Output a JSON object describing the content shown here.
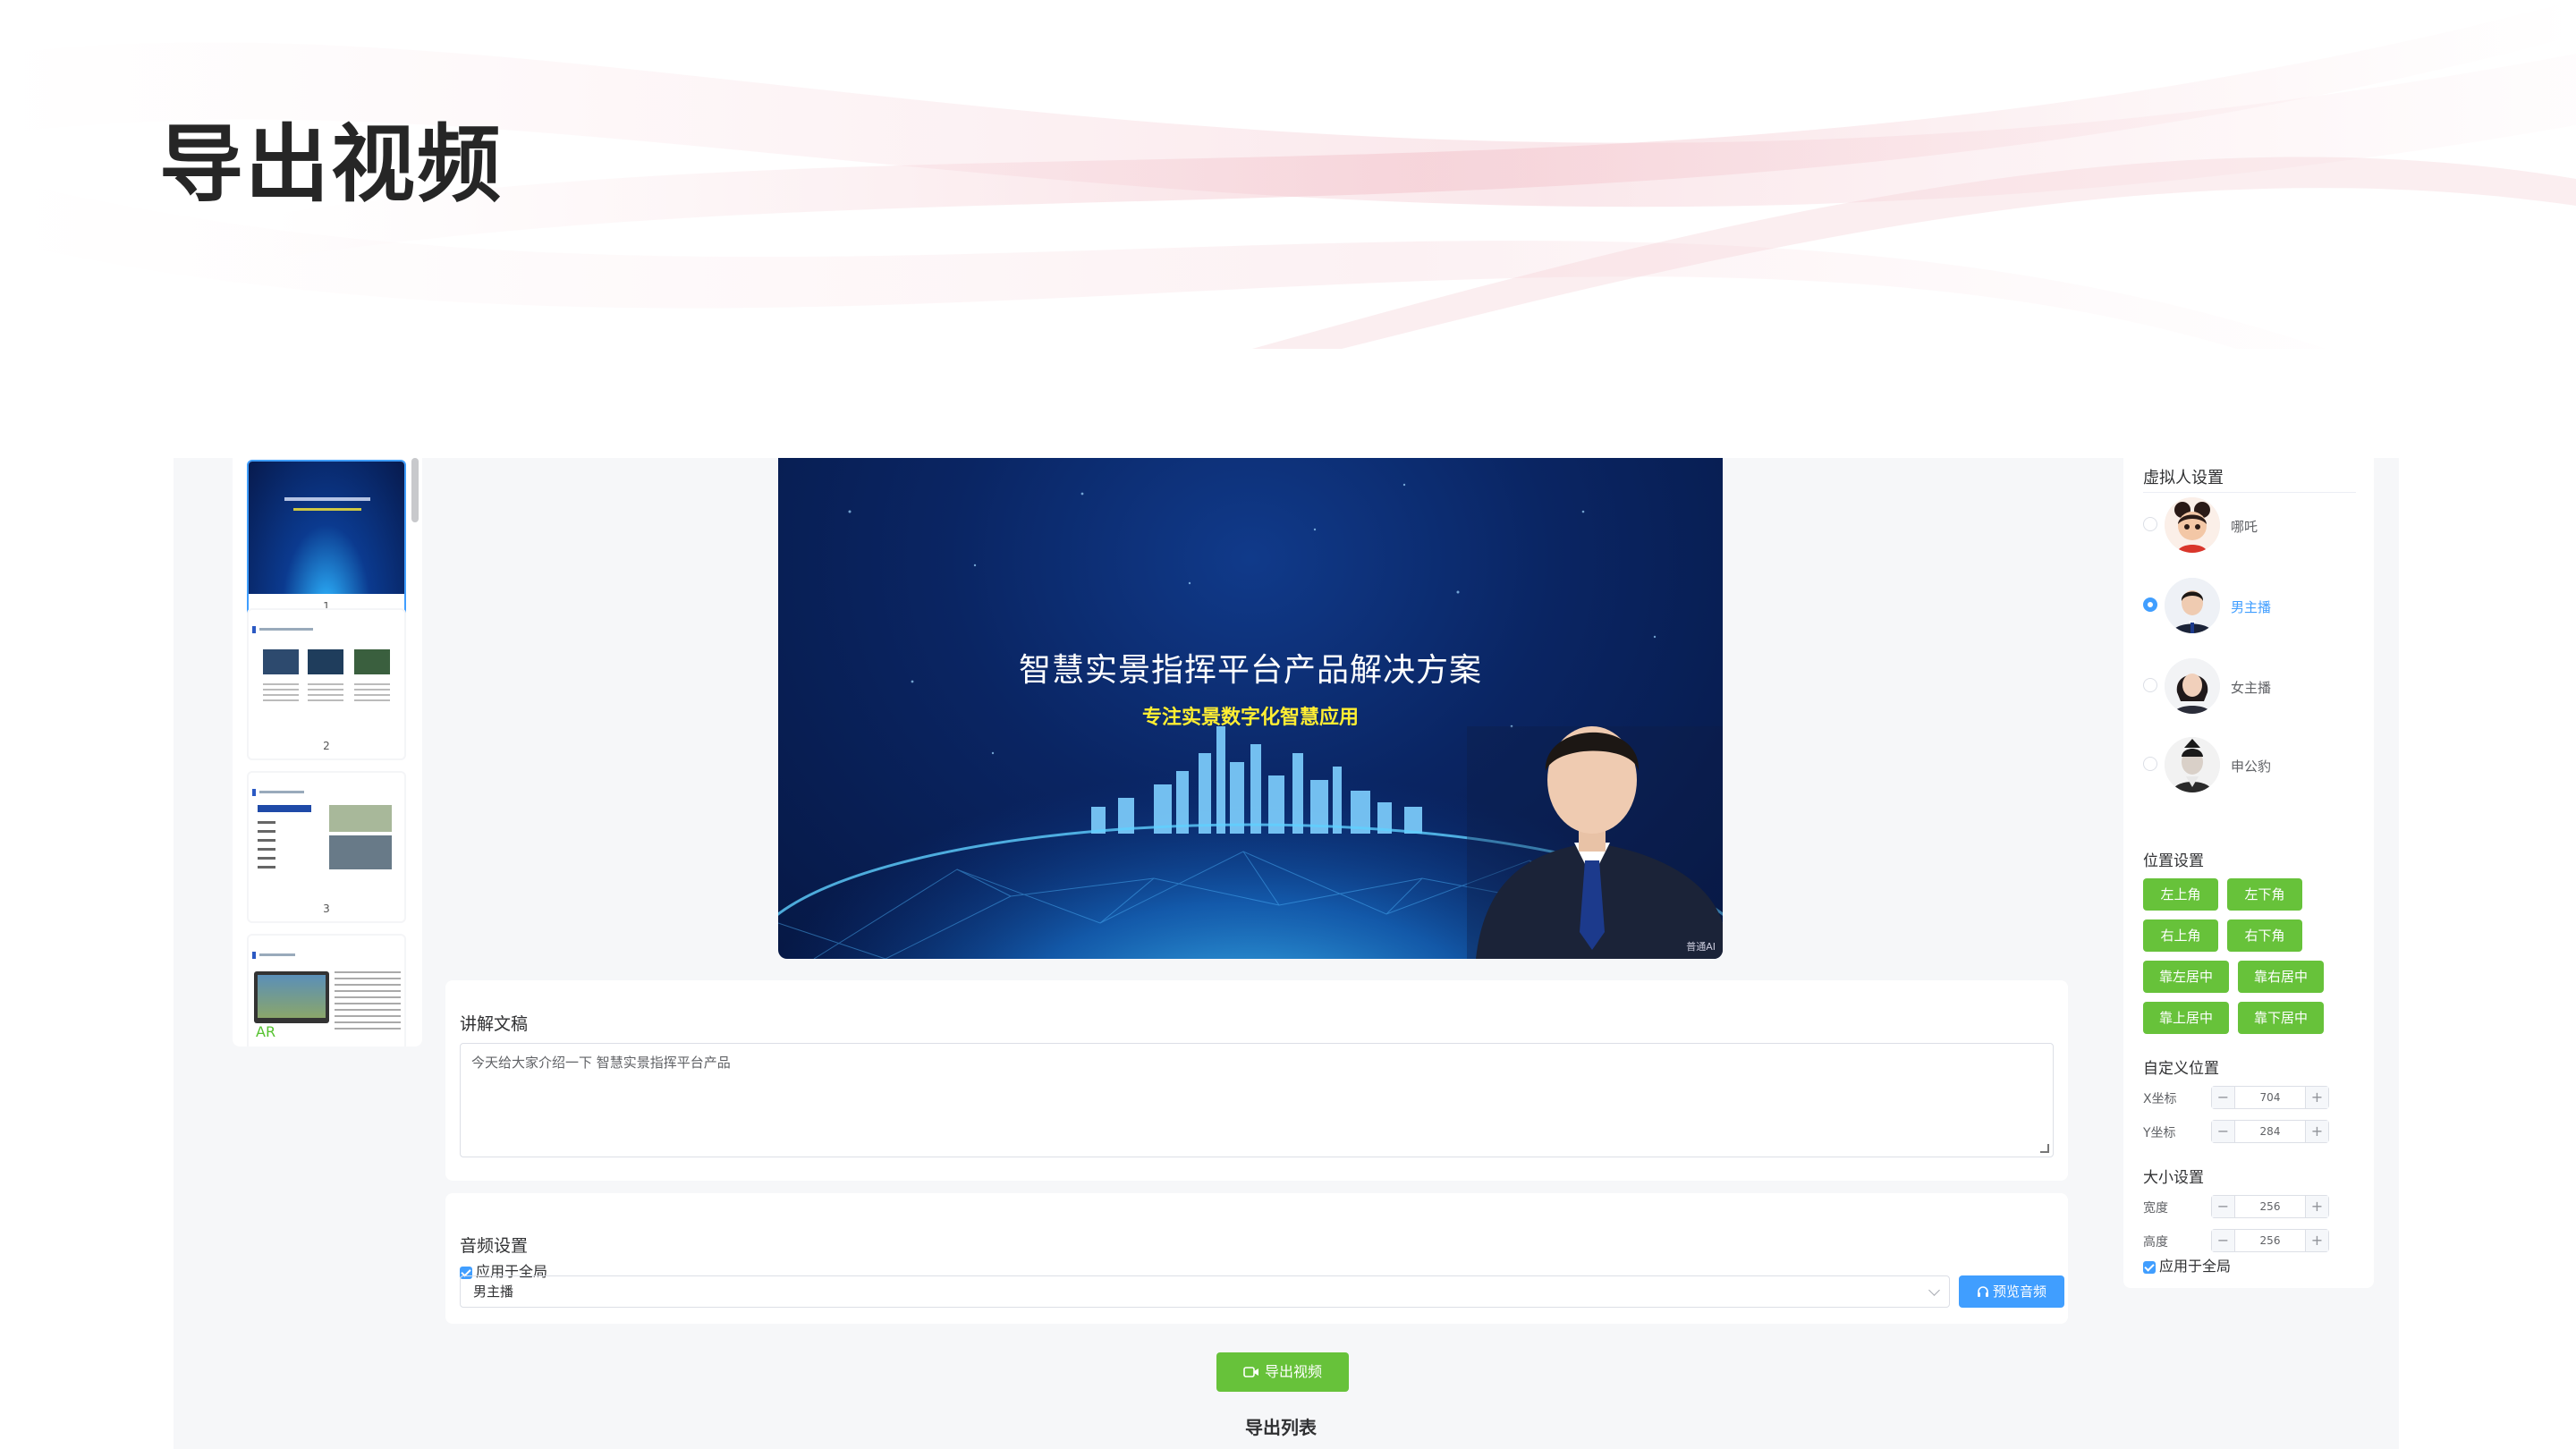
{
  "slide": {
    "title": "导出视频"
  },
  "thumbnails": [
    {
      "number": "1",
      "active": true
    },
    {
      "number": "2",
      "active": false
    },
    {
      "number": "3",
      "active": false
    },
    {
      "number": "",
      "active": false,
      "label": "AR"
    }
  ],
  "preview": {
    "title": "智慧实景指挥平台产品解决方案",
    "subtitle": "专注实景数字化智慧应用",
    "watermark": "普通AI"
  },
  "script": {
    "label": "讲解文稿",
    "text": "今天给大家介绍一下 智慧实景指挥平台产品"
  },
  "audio": {
    "label": "音频设置",
    "apply_global": "应用于全局",
    "voice": "男主播",
    "preview_button": "预览音频"
  },
  "export": {
    "button": "导出视频",
    "list_title": "导出列表"
  },
  "avatar_settings": {
    "title": "虚拟人设置",
    "options": [
      {
        "name": "哪吒",
        "selected": false
      },
      {
        "name": "男主播",
        "selected": true
      },
      {
        "name": "女主播",
        "selected": false
      },
      {
        "name": "申公豹",
        "selected": false
      }
    ]
  },
  "position_settings": {
    "title": "位置设置",
    "buttons": [
      "左上角",
      "左下角",
      "右上角",
      "右下角",
      "靠左居中",
      "靠右居中",
      "靠上居中",
      "靠下居中"
    ]
  },
  "custom_position": {
    "title": "自定义位置",
    "x_label": "X坐标",
    "x_value": "704",
    "y_label": "Y坐标",
    "y_value": "284"
  },
  "size_settings": {
    "title": "大小设置",
    "width_label": "宽度",
    "width_value": "256",
    "height_label": "高度",
    "height_value": "256",
    "apply_global": "应用于全局"
  },
  "colors": {
    "primary": "#409eff",
    "success": "#67c23a",
    "subtitle_yellow": "#ffee33"
  },
  "icons": {
    "minus": "−",
    "plus": "+",
    "headphone": "headphone-icon",
    "video": "video-camera-icon"
  }
}
